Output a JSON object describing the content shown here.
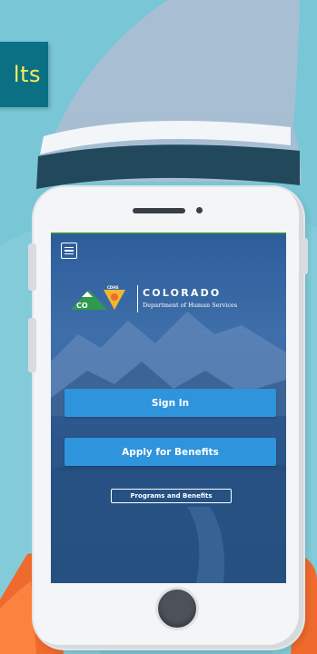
{
  "banner": {
    "text": "lts"
  },
  "phone_screen": {
    "brand": {
      "name": "COLORADO",
      "department": "Department of Human Services",
      "badge_text": "CDHS",
      "co_text": "CO"
    },
    "buttons": {
      "sign_in": "Sign In",
      "apply": "Apply for Benefits",
      "programs": "Programs and Benefits"
    },
    "icons": {
      "menu": "hamburger-menu-icon"
    }
  },
  "colors": {
    "background": "#79c6d6",
    "banner_bg": "#0c7085",
    "banner_text": "#f7ee5a",
    "primary_button": "#2e94db",
    "screen_bg": "#2f5f99",
    "rocket_orange": "#ef6a2c"
  }
}
